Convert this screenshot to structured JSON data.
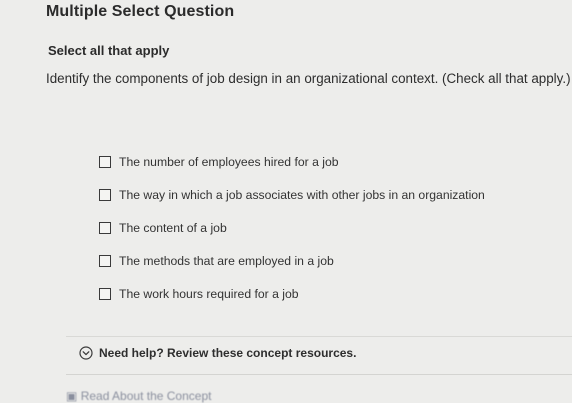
{
  "question": {
    "type_label": "Multiple Select Question",
    "instruction": "Select all that apply",
    "prompt": "Identify the components of job design in an organizational context. (Check all that apply.)"
  },
  "options": [
    {
      "label": "The number of employees hired for a job",
      "checked": false
    },
    {
      "label": "The way in which a job associates with other jobs in an organization",
      "checked": false
    },
    {
      "label": "The content of a job",
      "checked": false
    },
    {
      "label": "The methods that are employed in a job",
      "checked": false
    },
    {
      "label": "The work hours required for a job",
      "checked": false
    }
  ],
  "help": {
    "label": "Need help? Review these concept resources.",
    "icon": "chevron-circle-icon"
  },
  "resource": {
    "label": "Read About the Concept",
    "icon": "book-icon"
  },
  "colors": {
    "background": "#ededeb",
    "text": "#2a2a2a",
    "resource_link": "#8a8f9e"
  }
}
